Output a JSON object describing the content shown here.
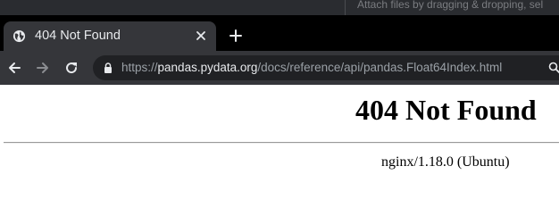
{
  "background_window": {
    "drop_hint": "Attach files by dragging & dropping, sel"
  },
  "tab": {
    "title": "404 Not Found",
    "favicon": "globe-icon",
    "close_icon": "close-icon"
  },
  "new_tab_icon": "plus-icon",
  "toolbar": {
    "back_icon": "arrow-left-icon",
    "forward_icon": "arrow-right-icon",
    "reload_icon": "reload-icon",
    "url_scheme": "https://",
    "url_host": "pandas.pydata.org",
    "url_path": "/docs/reference/api/pandas.Float64Index.html",
    "lock_icon": "lock-icon",
    "search_icon": "search-icon"
  },
  "page": {
    "heading": "404 Not Found",
    "server_info": "nginx/1.18.0 (Ubuntu)"
  },
  "colors": {
    "tab_bar": "#000000",
    "active_tab": "#35363a",
    "omnibox": "#202124",
    "page_background": "#ffffff"
  }
}
